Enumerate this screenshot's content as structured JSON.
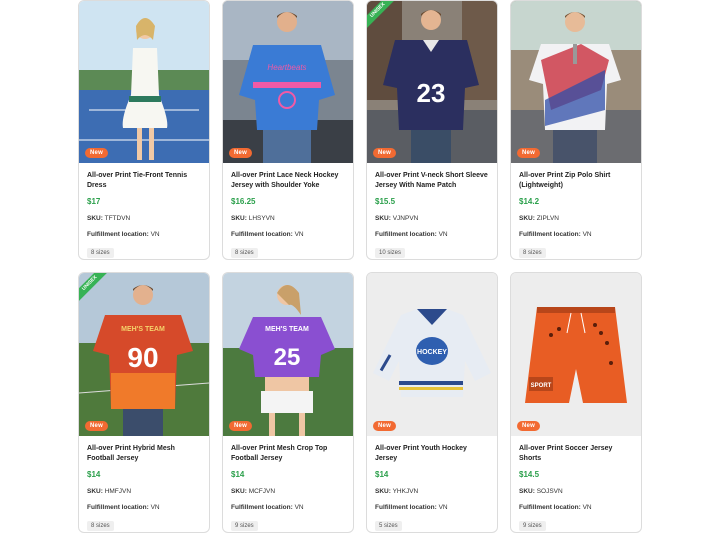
{
  "labels": {
    "new_badge": "New",
    "unisex_ribbon": "UNISEX",
    "sku_label": "SKU:",
    "fulfillment_label": "Fulfillment location:"
  },
  "products": [
    {
      "title": "All-over Print Tie-Front Tennis Dress",
      "price": "$17",
      "sku": "TFTDVN",
      "location": "VN",
      "sizes": "8 sizes"
    },
    {
      "title": "All-over Print Lace Neck Hockey Jersey with Shoulder Yoke",
      "price": "$16.25",
      "sku": "LHSYVN",
      "location": "VN",
      "sizes": "8 sizes"
    },
    {
      "title": "All-over Print V-neck Short Sleeve Jersey With Name Patch",
      "price": "$15.5",
      "sku": "VJNPVN",
      "location": "VN",
      "sizes": "10 sizes"
    },
    {
      "title": "All-over Print Zip Polo Shirt (Lightweight)",
      "price": "$14.2",
      "sku": "ZIPLVN",
      "location": "VN",
      "sizes": "8 sizes"
    },
    {
      "title": "All-over Print Hybrid Mesh Football Jersey",
      "price": "$14",
      "sku": "HMFJVN",
      "location": "VN",
      "sizes": "8 sizes"
    },
    {
      "title": "All-over Print Mesh Crop Top Football Jersey",
      "price": "$14",
      "sku": "MCFJVN",
      "location": "VN",
      "sizes": "9 sizes"
    },
    {
      "title": "All-over Print Youth Hockey Jersey",
      "price": "$14",
      "sku": "YHKJVN",
      "location": "VN",
      "sizes": "5 sizes"
    },
    {
      "title": "All-over Print Soccer Jersey Shorts",
      "price": "$14.5",
      "sku": "SOJSVN",
      "location": "VN",
      "sizes": "9 sizes"
    }
  ],
  "images": {
    "jersey_text_2": "Heartbeats",
    "jersey_number_3": "23",
    "jersey_team_5": "MEH'S TEAM",
    "jersey_number_5": "90",
    "jersey_team_6": "MEH'S TEAM",
    "jersey_number_6": "25",
    "hockey_logo_text": "HOCKEY",
    "shorts_text": "SPORT"
  }
}
